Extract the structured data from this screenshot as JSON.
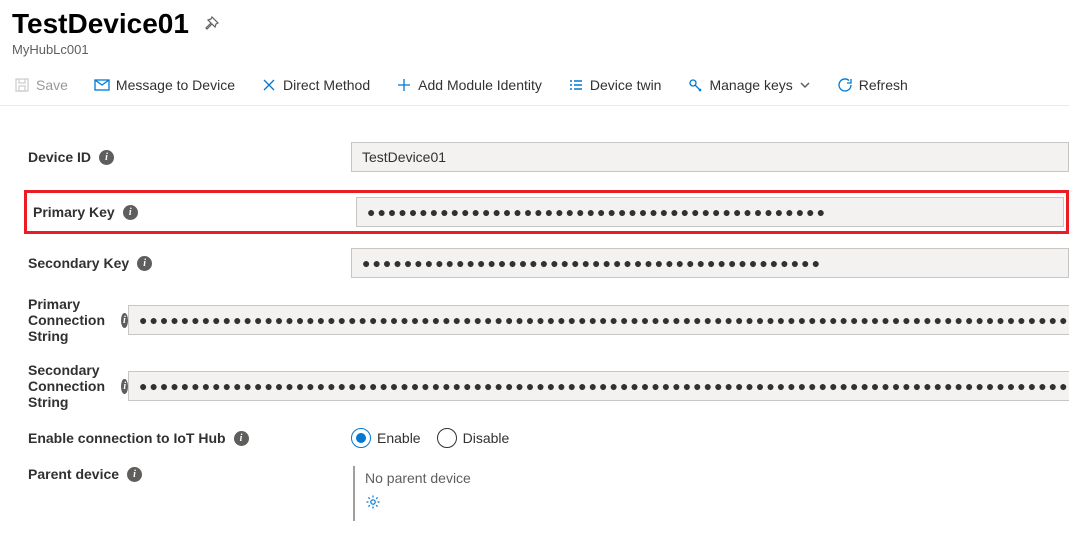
{
  "header": {
    "title": "TestDevice01",
    "subtitle": "MyHubLc001"
  },
  "toolbar": {
    "save": "Save",
    "message": "Message to Device",
    "direct": "Direct Method",
    "addModule": "Add Module Identity",
    "twin": "Device twin",
    "manageKeys": "Manage keys",
    "refresh": "Refresh"
  },
  "fields": {
    "deviceId": {
      "label": "Device ID",
      "value": "TestDevice01"
    },
    "primaryKey": {
      "label": "Primary Key",
      "value": "●●●●●●●●●●●●●●●●●●●●●●●●●●●●●●●●●●●●●●●●●●●●"
    },
    "secondaryKey": {
      "label": "Secondary Key",
      "value": "●●●●●●●●●●●●●●●●●●●●●●●●●●●●●●●●●●●●●●●●●●●●"
    },
    "primaryConn": {
      "label": "Primary Connection String",
      "value": "●●●●●●●●●●●●●●●●●●●●●●●●●●●●●●●●●●●●●●●●●●●●●●●●●●●●●●●●●●●●●●●●●●●●●●●●●●●●●●●●●●●●●●●●●●●●●●●●●●●●●●●●●●●●●●●●●●●●●●●●●●●●●●●●●●●●●●●●●●●●●●●●"
    },
    "secondaryConn": {
      "label": "Secondary Connection String",
      "value": "●●●●●●●●●●●●●●●●●●●●●●●●●●●●●●●●●●●●●●●●●●●●●●●●●●●●●●●●●●●●●●●●●●●●●●●●●●●●●●●●●●●●●●●●●●●●●●●●●●●●●●●●●●●●●●●●●●●●●●●●●●●●●●●●●●●●●●●●●●●●●●●●"
    },
    "enableConn": {
      "label": "Enable connection to IoT Hub",
      "enable": "Enable",
      "disable": "Disable",
      "selected": "enable"
    },
    "parent": {
      "label": "Parent device",
      "value": "No parent device"
    }
  }
}
